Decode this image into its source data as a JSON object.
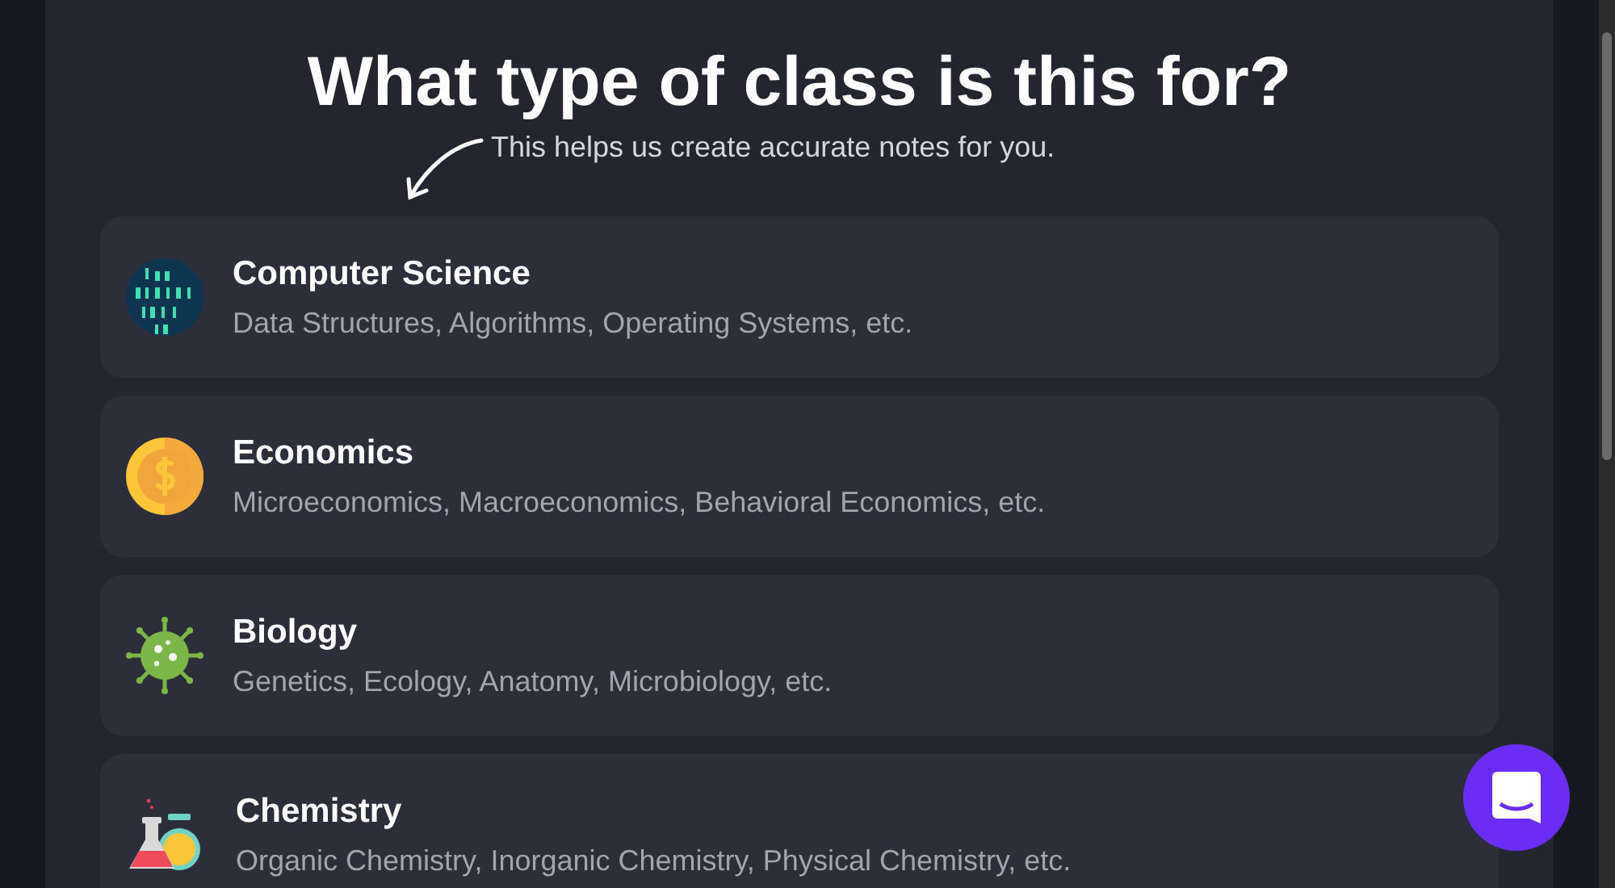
{
  "heading": "What type of class is this for?",
  "subheading": "This helps us create accurate notes for you.",
  "options": [
    {
      "kind": "binary",
      "title": "Computer Science",
      "examples": "Data Structures, Algorithms, Operating Systems, etc."
    },
    {
      "kind": "coin",
      "title": "Economics",
      "examples": "Microeconomics, Macroeconomics, Behavioral Economics, etc."
    },
    {
      "kind": "virus",
      "title": "Biology",
      "examples": "Genetics, Ecology, Anatomy, Microbiology, etc."
    },
    {
      "kind": "flask",
      "title": "Chemistry",
      "examples": "Organic Chemistry, Inorganic Chemistry, Physical Chemistry, etc."
    }
  ]
}
